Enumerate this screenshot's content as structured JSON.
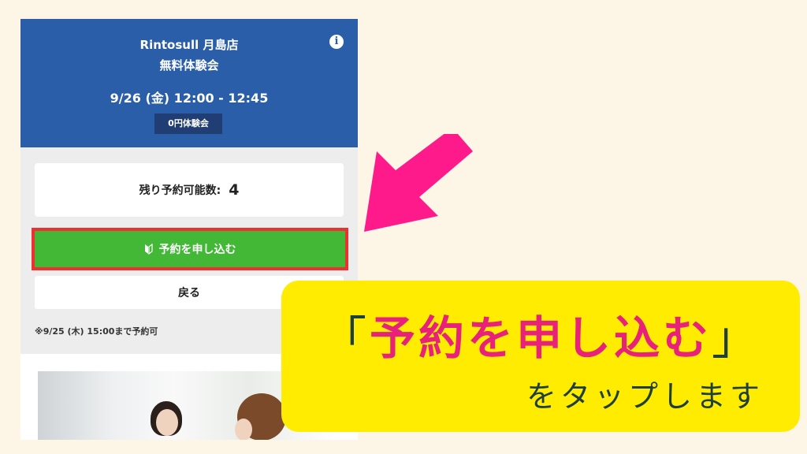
{
  "phone": {
    "header": {
      "store_name": "Rintosull 月島店",
      "event_name": "無料体験会",
      "datetime": "9/26 (金) 12:00 - 12:45",
      "badge": "0円体験会",
      "info_icon": "info-icon"
    },
    "remaining": {
      "label": "残り予約可能数:",
      "count": "4"
    },
    "apply_button_label": "予約を申し込む",
    "back_button_label": "戻る",
    "deadline_note": "※9/25 (木) 15:00まで予約可"
  },
  "callout": {
    "open_bracket": "「",
    "highlight": "予約を申し込む",
    "close_bracket": "」",
    "instruction": "をタップします"
  },
  "colors": {
    "background": "#fdf5e6",
    "header_blue": "#2b5ea8",
    "apply_green": "#42b836",
    "highlight_border": "#ee3030",
    "arrow_pink": "#ff1a8c",
    "callout_yellow": "#ffec00",
    "callout_pink_text": "#e8217a",
    "callout_dark_text": "#1f3f3a"
  }
}
